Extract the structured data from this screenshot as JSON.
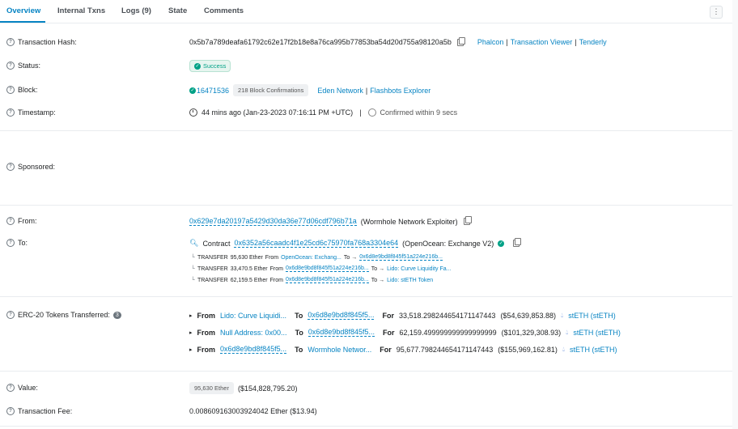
{
  "tabs": [
    {
      "label": "Overview"
    },
    {
      "label": "Internal Txns"
    },
    {
      "label": "Logs (9)"
    },
    {
      "label": "State"
    },
    {
      "label": "Comments"
    }
  ],
  "more_button": "⋮",
  "tx_hash": {
    "label": "Transaction Hash:",
    "value": "0x5b7a789deafa61792c62e17f2b18e8a76ca995b77853ba54d20d755a98120a5b",
    "links": [
      "Phalcon",
      "Transaction Viewer",
      "Tenderly"
    ]
  },
  "status": {
    "label": "Status:",
    "value": "Success"
  },
  "block": {
    "label": "Block:",
    "number": "16471536",
    "confirmations": "218 Block Confirmations",
    "links": [
      "Eden Network",
      "Flashbots Explorer"
    ]
  },
  "timestamp": {
    "label": "Timestamp:",
    "value": "44 mins ago (Jan-23-2023 07:16:11 PM +UTC)",
    "confirmed": "Confirmed within 9 secs"
  },
  "sponsored": {
    "label": "Sponsored:"
  },
  "from": {
    "label": "From:",
    "address": "0x629e7da20197a5429d30da36e77d06cdf796b71a",
    "name": "(Wormhole Network Exploiter)"
  },
  "to": {
    "label": "To:",
    "prefix": "Contract",
    "address": "0x6352a56caadc4f1e25cd6c75970fa768a3304e64",
    "name": "(OpenOcean: Exchange V2)",
    "transfers": [
      {
        "type": "TRANSFER",
        "amount": "95,630 Ether",
        "from_label": "From",
        "from": "OpenOcean: Exchang...",
        "to_label": "To →",
        "to": "0x6d8e9bd8f845f51a224e216b...",
        "from_dashed": false,
        "to_dashed": true
      },
      {
        "type": "TRANSFER",
        "amount": "33,470.5 Ether",
        "from_label": "From",
        "from": "0x6d8e9bd8f845f51a224e216b...",
        "to_label": "To →",
        "to": "Lido: Curve Liquidity Fa...",
        "from_dashed": true,
        "to_dashed": false
      },
      {
        "type": "TRANSFER",
        "amount": "62,159.5 Ether",
        "from_label": "From",
        "from": "0x6d8e9bd8f845f51a224e216b...",
        "to_label": "To →",
        "to": "Lido: stETH Token",
        "from_dashed": true,
        "to_dashed": false
      }
    ]
  },
  "erc20": {
    "label": "ERC-20 Tokens Transferred:",
    "count": "3",
    "rows": [
      {
        "from": "Lido: Curve Liquidi...",
        "to": "0x6d8e9bd8f845f5...",
        "for": "33,518.298244654171147443",
        "usd": "($54,639,853.88)",
        "token": "stETH (stETH)"
      },
      {
        "from": "Null Address: 0x00...",
        "to": "0x6d8e9bd8f845f5...",
        "for": "62,159.499999999999999999",
        "usd": "($101,329,308.93)",
        "token": "stETH (stETH)"
      },
      {
        "from": "0x6d8e9bd8f845f5...",
        "to": "Wormhole Networ...",
        "for": "95,677.798244654171147443",
        "usd": "($155,969,162.81)",
        "token": "stETH (stETH)"
      }
    ],
    "words": {
      "from": "From",
      "to": "To",
      "for": "For"
    }
  },
  "value": {
    "label": "Value:",
    "amount": "95,630 Ether",
    "usd": "($154,828,795.20)"
  },
  "fee": {
    "label": "Transaction Fee:",
    "value": "0.008609163003924042 Ether ($13.94)"
  }
}
